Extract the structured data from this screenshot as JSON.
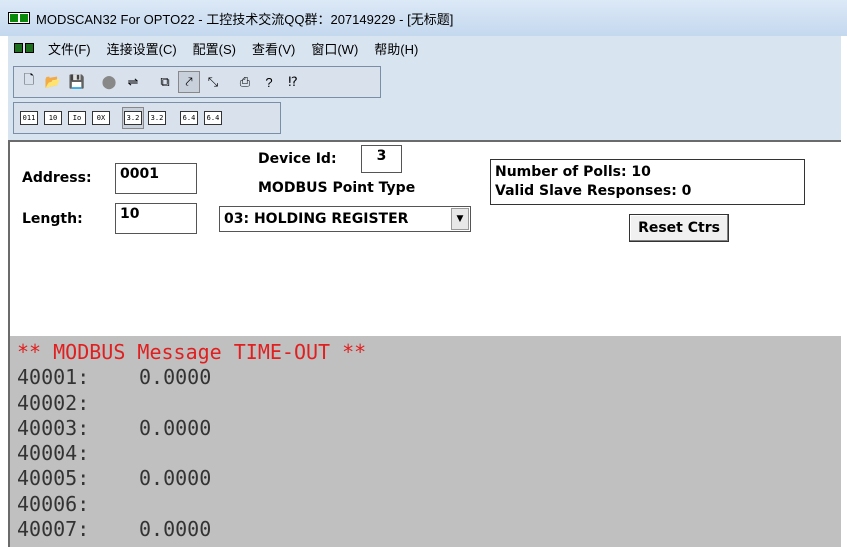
{
  "window": {
    "title": "MODSCAN32 For OPTO22 - 工控技术交流QQ群：207149229 - [无标题]"
  },
  "menu": [
    "文件(F)",
    "连接设置(C)",
    "配置(S)",
    "查看(V)",
    "窗口(W)",
    "帮助(H)"
  ],
  "toolbar1": {
    "new": "🗋",
    "open": "📂",
    "save": "💾",
    "connect": "⬤",
    "disconnect": "⇌",
    "view1": "⧉",
    "view2": "⤤",
    "view3": "⤡",
    "print": "⎙",
    "help": "?",
    "context_help": "⁉"
  },
  "toolbar2": [
    "011",
    "10",
    "Io",
    "0X",
    "3.2",
    "3.2",
    "6.4",
    "6.4"
  ],
  "settings": {
    "address_label": "Address:",
    "address_value": "0001",
    "length_label": "Length:",
    "length_value": "10",
    "device_id_label": "Device Id:",
    "device_id_value": "3",
    "point_type_label": "MODBUS Point Type",
    "point_type_value": "03: HOLDING REGISTER",
    "polls_label": "Number of Polls: 10",
    "responses_label": "Valid Slave Responses: 0",
    "reset_button": "Reset Ctrs"
  },
  "data_area": {
    "error": "** MODBUS Message TIME-OUT **",
    "rows": [
      {
        "addr": "40001:",
        "value": "0.0000"
      },
      {
        "addr": "40002:",
        "value": ""
      },
      {
        "addr": "40003:",
        "value": "0.0000"
      },
      {
        "addr": "40004:",
        "value": ""
      },
      {
        "addr": "40005:",
        "value": "0.0000"
      },
      {
        "addr": "40006:",
        "value": ""
      },
      {
        "addr": "40007:",
        "value": "0.0000"
      }
    ]
  }
}
